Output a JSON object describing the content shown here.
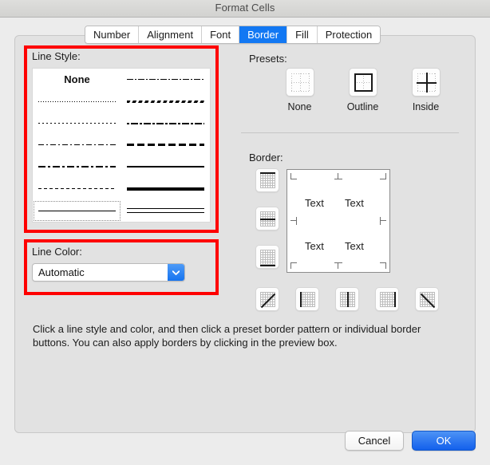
{
  "window": {
    "title": "Format Cells"
  },
  "tabs": [
    {
      "label": "Number",
      "active": false
    },
    {
      "label": "Alignment",
      "active": false
    },
    {
      "label": "Font",
      "active": false
    },
    {
      "label": "Border",
      "active": true
    },
    {
      "label": "Fill",
      "active": false
    },
    {
      "label": "Protection",
      "active": false
    }
  ],
  "line_style": {
    "label": "Line Style:",
    "none_label": "None",
    "selected_index": 12,
    "options": [
      {
        "name": "none",
        "swatch": "none"
      },
      {
        "name": "dash-dot-dot-thin",
        "swatch": "sw-dashdotdot-thin"
      },
      {
        "name": "dotted-fine",
        "swatch": "sw-dotted-fine"
      },
      {
        "name": "slant-dash",
        "swatch": "sw-slant-dash"
      },
      {
        "name": "dotted-medium",
        "swatch": "sw-dotted-med"
      },
      {
        "name": "dash-dot-dot-medium",
        "swatch": "sw-dashdotdot-med"
      },
      {
        "name": "dash-dot-thin",
        "swatch": "sw-dashdot-thin"
      },
      {
        "name": "dashed-medium",
        "swatch": "sw-dashed-med"
      },
      {
        "name": "dash-dot-long-thin",
        "swatch": "sw-dashdot-med"
      },
      {
        "name": "solid-thin",
        "swatch": "sw-solid-thin"
      },
      {
        "name": "dashed-thin",
        "swatch": "sw-dashed-thin"
      },
      {
        "name": "solid-thick",
        "swatch": "sw-solid-thick"
      },
      {
        "name": "solid-hairline",
        "swatch": "sw-solid-hair"
      },
      {
        "name": "double",
        "swatch": "sw-double"
      }
    ]
  },
  "line_color": {
    "label": "Line Color:",
    "value": "Automatic",
    "arrow_icon": "chevron-down-icon"
  },
  "presets": {
    "label": "Presets:",
    "items": [
      {
        "label": "None",
        "icon": "preset-none-icon"
      },
      {
        "label": "Outline",
        "icon": "preset-outline-icon"
      },
      {
        "label": "Inside",
        "icon": "preset-inside-icon"
      }
    ]
  },
  "border": {
    "label": "Border:",
    "side_buttons": [
      {
        "name": "border-top-button",
        "icon": "border-top-icon"
      },
      {
        "name": "border-middle-button",
        "icon": "border-middle-horizontal-icon"
      },
      {
        "name": "border-bottom-button",
        "icon": "border-bottom-icon"
      }
    ],
    "bottom_buttons": [
      {
        "name": "border-diagonal-up-button",
        "icon": "diagonal-up-icon"
      },
      {
        "name": "border-left-button",
        "icon": "border-left-icon"
      },
      {
        "name": "border-middle-vertical-button",
        "icon": "border-middle-vertical-icon"
      },
      {
        "name": "border-right-button",
        "icon": "border-right-icon"
      },
      {
        "name": "border-diagonal-down-button",
        "icon": "diagonal-down-icon"
      }
    ],
    "preview_cells": [
      "Text",
      "Text",
      "Text",
      "Text"
    ]
  },
  "help": {
    "text": "Click a line style and color, and then click a preset border pattern or individual border buttons. You can also apply borders by clicking in the preview box."
  },
  "footer": {
    "cancel_label": "Cancel",
    "ok_label": "OK"
  },
  "colors": {
    "accent_blue": "#1278f3",
    "ok_button_blue": "#1360ec",
    "highlight_red": "#fe0000",
    "dialog_bg": "#ececec",
    "panel_bg": "#e2e2e2"
  }
}
